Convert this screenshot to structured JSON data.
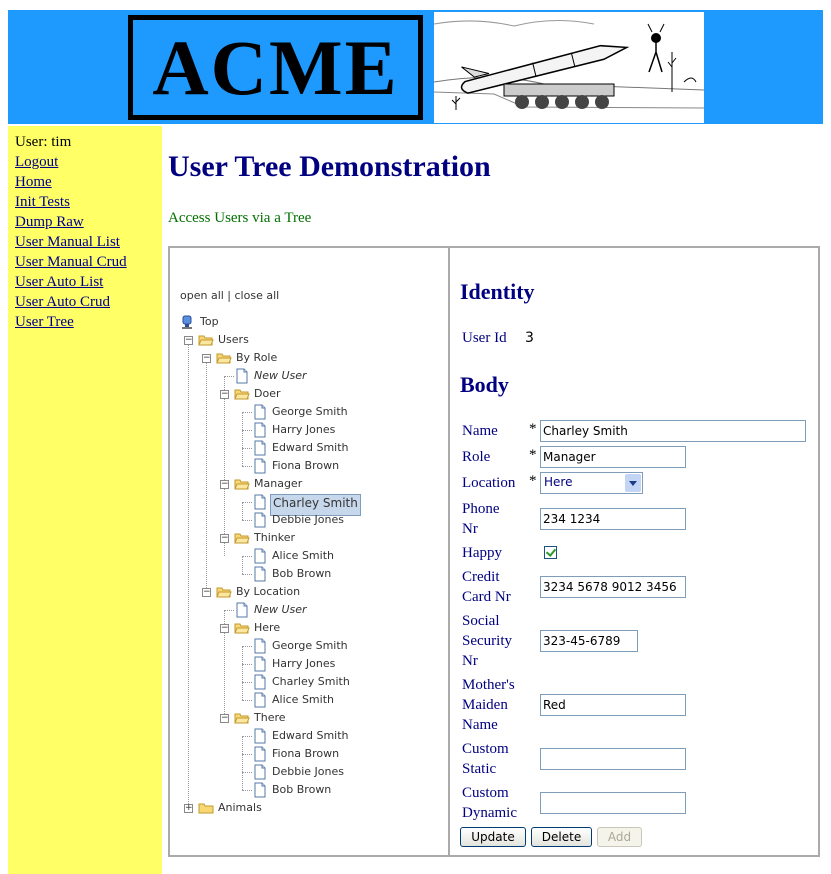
{
  "header": {
    "logo_text": "ACME"
  },
  "sidebar": {
    "user_label": "User: tim",
    "links": [
      "Logout",
      "Home",
      "Init Tests",
      "Dump Raw",
      "User Manual List",
      "User Manual Crud",
      "User Auto List",
      "User Auto Crud",
      "User Tree"
    ]
  },
  "page": {
    "title": "User Tree Demonstration",
    "subtitle": "Access Users via a Tree"
  },
  "tree": {
    "open_close": "open all | close all",
    "nodes": [
      {
        "label": "Top",
        "type": "root"
      },
      {
        "label": "Users",
        "type": "folder"
      },
      {
        "label": "By Role",
        "type": "folder"
      },
      {
        "label": "New User",
        "type": "page"
      },
      {
        "label": "Doer",
        "type": "folder"
      },
      {
        "label": "George Smith",
        "type": "page"
      },
      {
        "label": "Harry Jones",
        "type": "page"
      },
      {
        "label": "Edward Smith",
        "type": "page"
      },
      {
        "label": "Fiona Brown",
        "type": "page"
      },
      {
        "label": "Manager",
        "type": "folder"
      },
      {
        "label": "Charley Smith",
        "type": "page",
        "selected": true
      },
      {
        "label": "Debbie Jones",
        "type": "page"
      },
      {
        "label": "Thinker",
        "type": "folder"
      },
      {
        "label": "Alice Smith",
        "type": "page"
      },
      {
        "label": "Bob Brown",
        "type": "page"
      },
      {
        "label": "By Location",
        "type": "folder"
      },
      {
        "label": "New User",
        "type": "page"
      },
      {
        "label": "Here",
        "type": "folder"
      },
      {
        "label": "George Smith",
        "type": "page"
      },
      {
        "label": "Harry Jones",
        "type": "page"
      },
      {
        "label": "Charley Smith",
        "type": "page"
      },
      {
        "label": "Alice Smith",
        "type": "page"
      },
      {
        "label": "There",
        "type": "folder"
      },
      {
        "label": "Edward Smith",
        "type": "page"
      },
      {
        "label": "Fiona Brown",
        "type": "page"
      },
      {
        "label": "Debbie Jones",
        "type": "page"
      },
      {
        "label": "Bob Brown",
        "type": "page"
      },
      {
        "label": "Animals",
        "type": "folder",
        "collapsed": true
      }
    ]
  },
  "form": {
    "identity_heading": "Identity",
    "user_id_label": "User Id",
    "user_id_value": "3",
    "body_heading": "Body",
    "required_mark": "*",
    "name_label": "Name",
    "name_value": "Charley Smith",
    "role_label": "Role",
    "role_value": "Manager",
    "location_label": "Location",
    "location_value": "Here",
    "phone_label_1": "Phone",
    "phone_label_2": "Nr",
    "phone_value": "234 1234",
    "happy_label": "Happy",
    "happy_checked": true,
    "cc_label_1": "Credit",
    "cc_label_2": "Card Nr",
    "cc_value": "3234 5678 9012 3456",
    "ssn_label_1": "Social",
    "ssn_label_2": "Security",
    "ssn_label_3": "Nr",
    "ssn_value": "323-45-6789",
    "maiden_label_1": "Mother's",
    "maiden_label_2": "Maiden",
    "maiden_label_3": "Name",
    "maiden_value": "Red",
    "cstatic_label_1": "Custom",
    "cstatic_label_2": "Static",
    "cstatic_value": "",
    "cdynamic_label_1": "Custom",
    "cdynamic_label_2": "Dynamic",
    "cdynamic_value": "",
    "update_label": "Update",
    "delete_label": "Delete",
    "add_label": "Add"
  },
  "colors": {
    "header_bg": "#1e9aff",
    "sidebar_bg": "#ffff66",
    "title": "#000080",
    "subtitle": "#007000"
  }
}
